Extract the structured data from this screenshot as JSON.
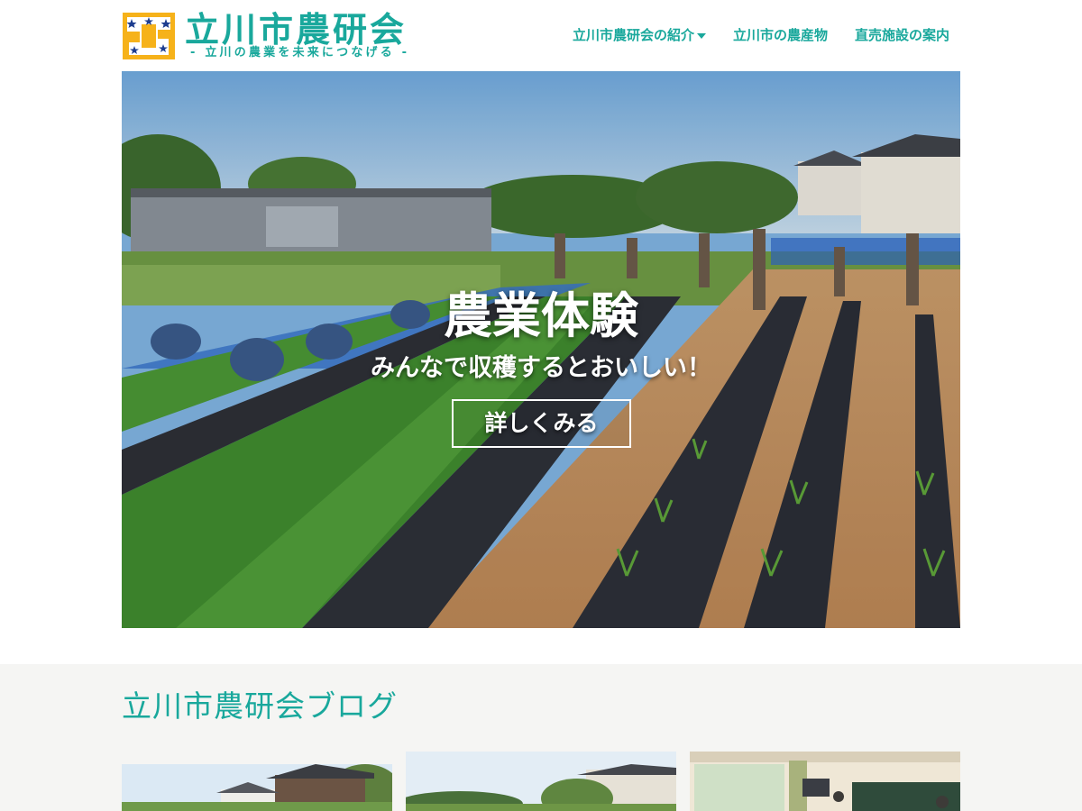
{
  "header": {
    "logo_title": "立川市農研会",
    "logo_tagline": "- 立川の農業を未来につなげる -",
    "nav": [
      {
        "label": "立川市農研会の紹介",
        "has_dropdown": true,
        "icon": "chevron-down-icon"
      },
      {
        "label": "立川市の農産物",
        "has_dropdown": false
      },
      {
        "label": "直売施設の案内",
        "has_dropdown": false
      }
    ]
  },
  "hero": {
    "title": "農業体験",
    "subtitle": "みんなで収穫するとおいしい！",
    "button_label": "詳しくみる"
  },
  "blog": {
    "title": "立川市農研会ブログ"
  },
  "colors": {
    "accent": "#19a89c",
    "section_bg": "#f5f5f3"
  }
}
